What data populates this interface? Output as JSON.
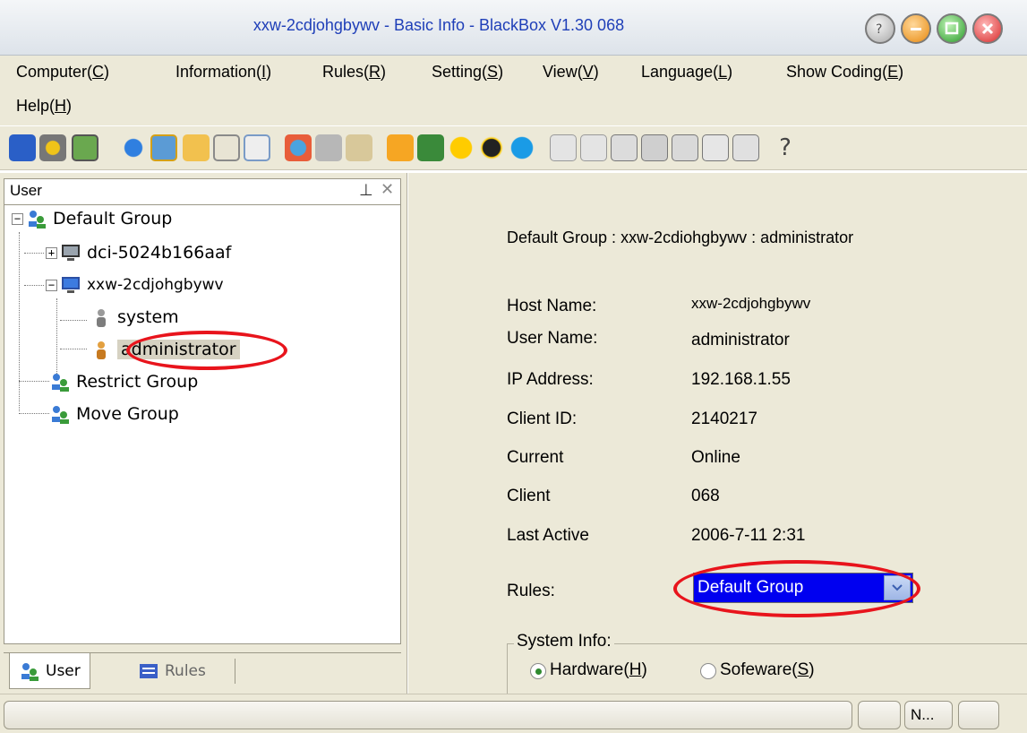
{
  "window": {
    "title": "xxw-2cdjohgbywv - Basic Info - BlackBox V1.30 068"
  },
  "menu": {
    "items": [
      {
        "label_pre": "Computer(",
        "hot": "C",
        "label_post": ")"
      },
      {
        "label_pre": "Information(",
        "hot": "I",
        "label_post": ")"
      },
      {
        "label_pre": "Rules(",
        "hot": "R",
        "label_post": ")"
      },
      {
        "label_pre": "Setting(",
        "hot": "S",
        "label_post": ")"
      },
      {
        "label_pre": "View(",
        "hot": "V",
        "label_post": ")"
      },
      {
        "label_pre": "Language(",
        "hot": "L",
        "label_post": ")"
      },
      {
        "label_pre": "Show Coding(",
        "hot": "E",
        "label_post": ")"
      },
      {
        "label_pre": "Help(",
        "hot": "H",
        "label_post": ")"
      }
    ]
  },
  "toolbar": {
    "icons": [
      "computer-icon",
      "gear-settings-icon",
      "image-icon",
      "ie-browser-icon",
      "monitor-icon",
      "folder-icon",
      "window-icon",
      "chat-icon",
      "network-icon",
      "satellite-icon",
      "message-icon",
      "game-icon",
      "lite-app-icon",
      "smiley-icon",
      "penguin-qq-icon",
      "skype-icon",
      "usb-icon",
      "cable-icon",
      "document-icon",
      "disk-icon",
      "photo-icon",
      "edit-document-icon",
      "diagram-icon",
      "help-icon"
    ]
  },
  "left_panel": {
    "title": "User",
    "tree": {
      "default_group": "Default Group",
      "computer1": "dci-5024b166aaf",
      "computer2": "xxw-2cdjohgbywv",
      "user_system": "system",
      "user_admin": "administrator",
      "restrict_group": "Restrict Group",
      "move_group": "Move Group"
    },
    "tabs": {
      "user": "User",
      "rules": "Rules"
    }
  },
  "details": {
    "path": "Default Group : xxw-2cdiohgbywv : administrator",
    "labels": {
      "host": "Host Name:",
      "user": "User Name:",
      "ip": "IP Address:",
      "client_id": "Client ID:",
      "current": "Current",
      "client": "Client",
      "last_active": "Last Active",
      "rules": "Rules:"
    },
    "values": {
      "host": "xxw-2cdjohgbywv",
      "user": "administrator",
      "ip": "192.168.1.55",
      "client_id": "2140217",
      "current": "Online",
      "client": "068",
      "last_active": "2006-7-11 2:31",
      "rules": "Default Group"
    },
    "system_info": {
      "legend": "System Info:",
      "hardware_pre": "Hardware(",
      "hardware_hot": "H",
      "hardware_post": ")",
      "software_pre": "Sofeware(",
      "software_hot": "S",
      "software_post": ")"
    }
  },
  "status_bar": {
    "indicator": "N..."
  },
  "colors": {
    "highlight_ellipse": "#e8141c",
    "selection_blue": "#0000f0",
    "title_text": "#1f3fb8"
  }
}
